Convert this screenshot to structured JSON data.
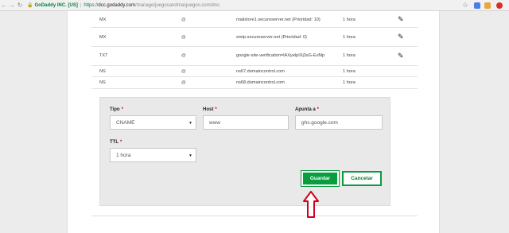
{
  "browser": {
    "organization": "GoDaddy INC. [US]",
    "scheme": "https://",
    "host": "dcc.godaddy.com",
    "path": "/manage/juegosandmasjuegos.com/dns",
    "extension_colors": [
      "#4a7fe8",
      "#e8a63b",
      "#d93025"
    ]
  },
  "records": [
    {
      "type": "MX",
      "name": "@",
      "value": "mailstore1.secureserver.net (Prioridad: 10)",
      "ttl": "1 hora",
      "editable": true
    },
    {
      "type": "MX",
      "name": "@",
      "value": "smtp.secureserver.net (Prioridad: 0)",
      "ttl": "1 hora",
      "editable": true
    },
    {
      "type": "TXT",
      "name": "@",
      "value": "google-site-verification=lAXyelpIXj3sG-EvMp",
      "ttl": "1 hora",
      "editable": true
    },
    {
      "type": "NS",
      "name": "@",
      "value": "ns67.domaincontrol.com",
      "ttl": "1 hora",
      "editable": false
    },
    {
      "type": "NS",
      "name": "@",
      "value": "ns68.domaincontrol.com",
      "ttl": "1 hora",
      "editable": false
    }
  ],
  "form": {
    "type_label": "Tipo",
    "type_value": "CNAME",
    "host_label": "Host",
    "host_value": "www",
    "points_label": "Apunta a",
    "points_value": "ghs.google.com",
    "ttl_label": "TTL",
    "ttl_value": "1 hora",
    "required_mark": "*",
    "save_label": "Guardar",
    "cancel_label": "Cancelar"
  },
  "colors": {
    "primary": "#0a9c3f",
    "arrow": "#d0021b"
  }
}
